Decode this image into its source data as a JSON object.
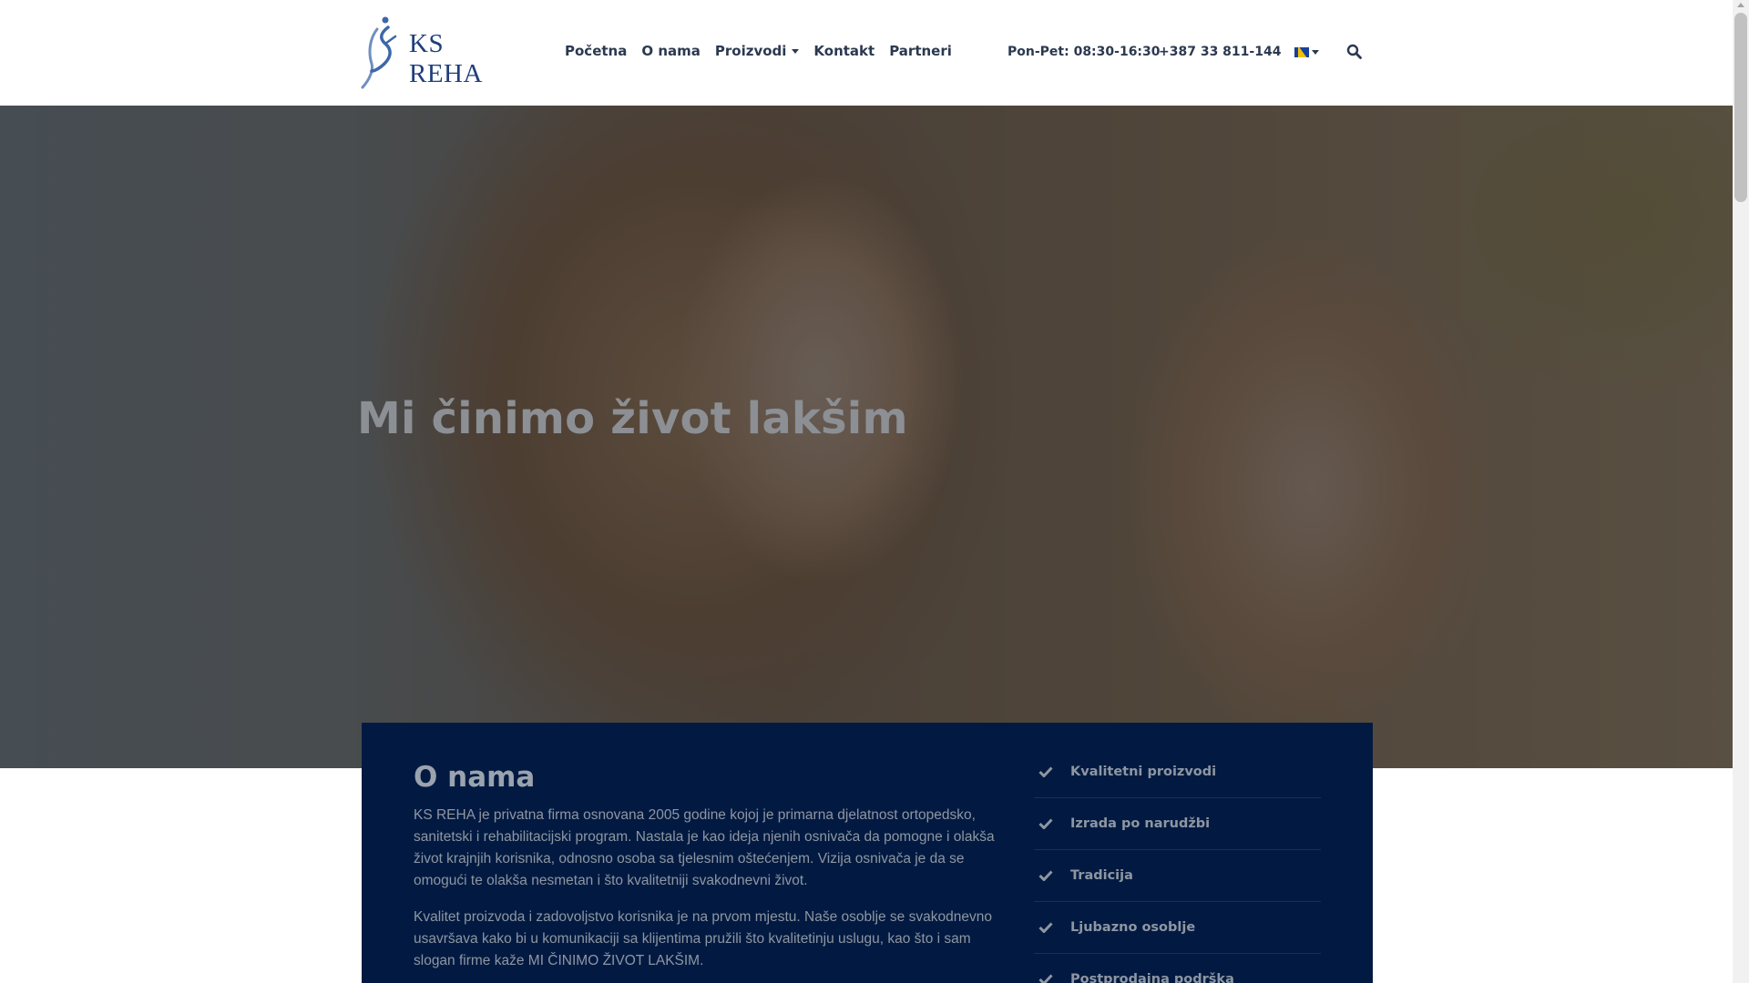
{
  "header": {
    "logo_text": "KS REHA",
    "nav": [
      {
        "label": "Početna"
      },
      {
        "label": "O nama"
      },
      {
        "label": "Proizvodi",
        "has_dropdown": true
      },
      {
        "label": "Kontakt"
      },
      {
        "label": "Partneri"
      }
    ],
    "hours": "Pon-Pet: 08:30-16:30",
    "phone": "+387 33 811-144",
    "language_icon": "bosnia-flag-icon",
    "search_icon": "search-icon"
  },
  "hero": {
    "title": "Mi činimo život lakšim"
  },
  "about": {
    "title": "O nama",
    "paragraphs": [
      "KS REHA je privatna firma osnovana 2005 godine kojoj je primarna djelatnost ortopedsko, sanitetski i rehabilitacijski program. Nastala je kao ideja njenih osnivača da pomogne i olakša život krajnjih korisnika, odnosno osoba sa tjelesnim oštećenjem. Vizija osnivača je da se omogući te olakša nesmetan i što kvalitetniji svakodnevni život.",
      "Kvalitet proizvoda i zadovoljstvo korisnika je na prvom mjestu. Naše osoblje se svakodnevno usavršava kako bi u komunikaciji sa klijentima pružili što kvalitetinju uslugu, kao što i sam slogan firme kaže MI ČINIMO ŽIVOT LAKŠIM."
    ],
    "features": [
      "Kvalitetni proizvodi",
      "Izrada po narudžbi",
      "Tradicija",
      "Ljubazno osoblje",
      "Postprodajna podrška"
    ]
  },
  "colors": {
    "nav_text": "#2b3950",
    "logo": "#1f3f7a",
    "card_bg": "#021a41"
  }
}
